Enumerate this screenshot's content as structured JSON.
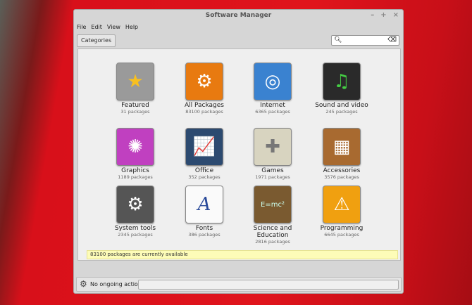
{
  "window": {
    "title": "Software Manager",
    "controls": [
      "–",
      "+",
      "×"
    ]
  },
  "menu": [
    "File",
    "Edit",
    "View",
    "Help"
  ],
  "toolbar": {
    "categories_label": "Categories",
    "search_placeholder": ""
  },
  "categories": [
    {
      "label": "Featured",
      "count": "31 packages",
      "color": "#9a9a9a",
      "glyph": "★"
    },
    {
      "label": "All Packages",
      "count": "83100 packages",
      "color": "#e87a10",
      "glyph": "⚙"
    },
    {
      "label": "Internet",
      "count": "6365 packages",
      "color": "#3a82d0",
      "glyph": "◎"
    },
    {
      "label": "Sound and video",
      "count": "245 packages",
      "color": "#2a2a2a",
      "glyph": "♫"
    },
    {
      "label": "Graphics",
      "count": "1189 packages",
      "color": "#c040c0",
      "glyph": "✺"
    },
    {
      "label": "Office",
      "count": "352 packages",
      "color": "#2c4a70",
      "glyph": "📈"
    },
    {
      "label": "Games",
      "count": "1971 packages",
      "color": "#d8d4c0",
      "glyph": "✚"
    },
    {
      "label": "Accessories",
      "count": "3576 packages",
      "color": "#a86a30",
      "glyph": "▦"
    },
    {
      "label": "System tools",
      "count": "2345 packages",
      "color": "#555",
      "glyph": "⚙"
    },
    {
      "label": "Fonts",
      "count": "386 packages",
      "color": "#fafafa",
      "glyph": "A"
    },
    {
      "label": "Science and Education",
      "count": "2816 packages",
      "color": "#7a5a30",
      "glyph": "E=mc²"
    },
    {
      "label": "Programming",
      "count": "6645 packages",
      "color": "#f0a010",
      "glyph": "⚠"
    }
  ],
  "notice": "83100 packages are currently available",
  "status": {
    "text": "No ongoing actions"
  }
}
